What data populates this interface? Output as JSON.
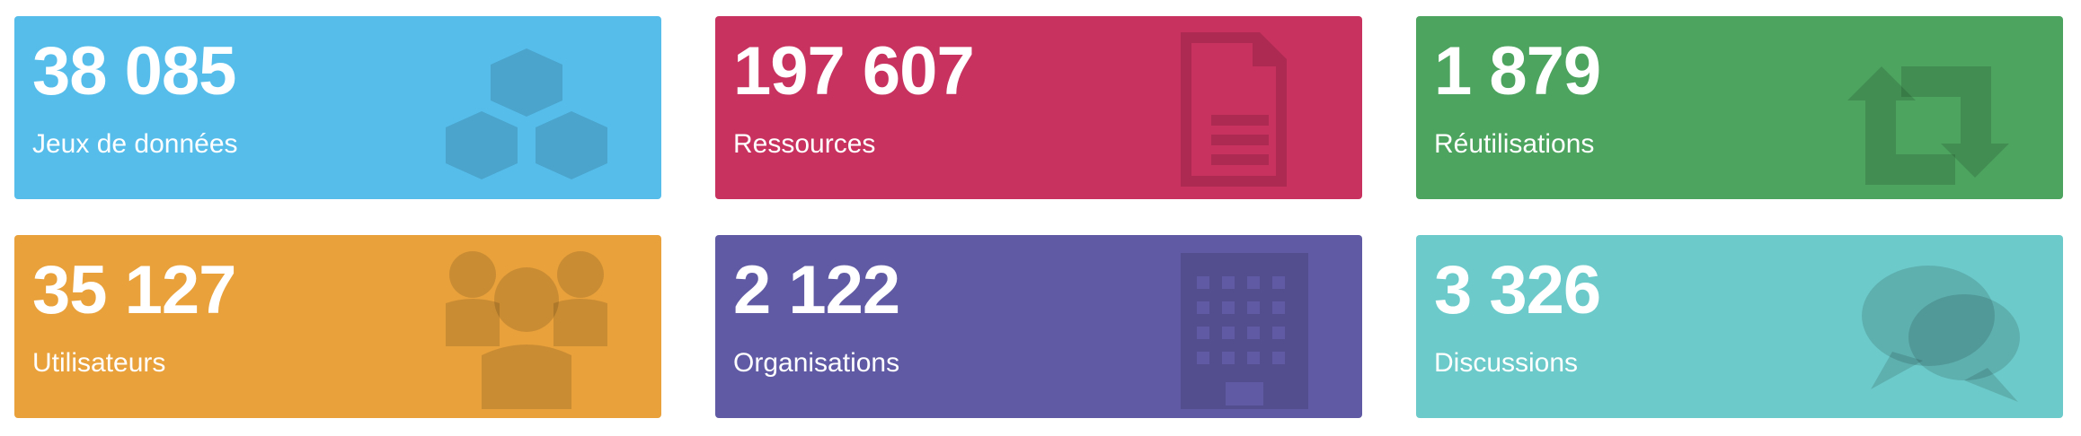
{
  "tiles": [
    {
      "value": "38 085",
      "label": "Jeux de données",
      "icon": "cubes-icon",
      "color": "#56bdeb"
    },
    {
      "value": "197 607",
      "label": "Ressources",
      "icon": "file-text-icon",
      "color": "#c7325f"
    },
    {
      "value": "1 879",
      "label": "Réutilisations",
      "icon": "retweet-icon",
      "color": "#4ca45f"
    },
    {
      "value": "35 127",
      "label": "Utilisateurs",
      "icon": "users-icon",
      "color": "#e9a13b"
    },
    {
      "value": "2 122",
      "label": "Organisations",
      "icon": "building-icon",
      "color": "#605aa4"
    },
    {
      "value": "3 326",
      "label": "Discussions",
      "icon": "comments-icon",
      "color": "#6ccbca"
    }
  ]
}
